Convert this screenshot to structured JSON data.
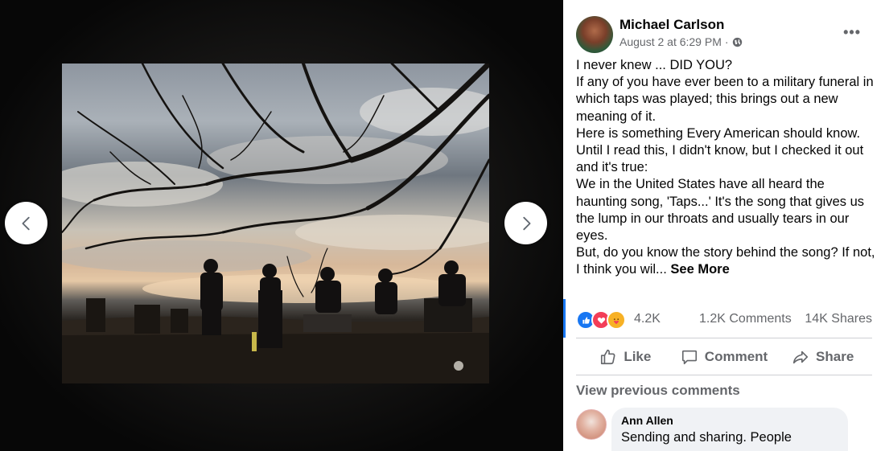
{
  "viewer": {
    "prev_icon": "chevron-left-icon",
    "next_icon": "chevron-right-icon"
  },
  "post": {
    "author": "Michael Carlson",
    "date": "August 2 at 6:29 PM",
    "date_separator": "·",
    "privacy_icon": "globe-icon",
    "more_label": "•••",
    "text_lines": [
      "I never knew ... DID YOU?",
      "If any of you have ever been to a military funeral in which taps was played; this brings out a new meaning of it.",
      "Here is something Every American should know. Until I read this, I didn't know, but I checked it out and it's true:",
      "We in the United States have all heard the haunting song, 'Taps...' It's the song that gives us the lump in our throats and usually tears in our eyes."
    ],
    "last_line": "But, do you know the story behind the song? If not, I think you wil...",
    "see_more": "See More"
  },
  "stats": {
    "reactions": [
      "like",
      "love",
      "care"
    ],
    "reaction_count": "4.2K",
    "comments": "1.2K Comments",
    "shares": "14K Shares"
  },
  "actions": {
    "like": "Like",
    "comment": "Comment",
    "share": "Share"
  },
  "comments_section": {
    "view_previous": "View previous comments",
    "first": {
      "author": "Ann Allen",
      "text": "Sending and sharing. People"
    }
  },
  "colors": {
    "accent": "#1877f2",
    "love": "#f33e58",
    "care": "#f7b125",
    "secondary_text": "#65676b"
  }
}
